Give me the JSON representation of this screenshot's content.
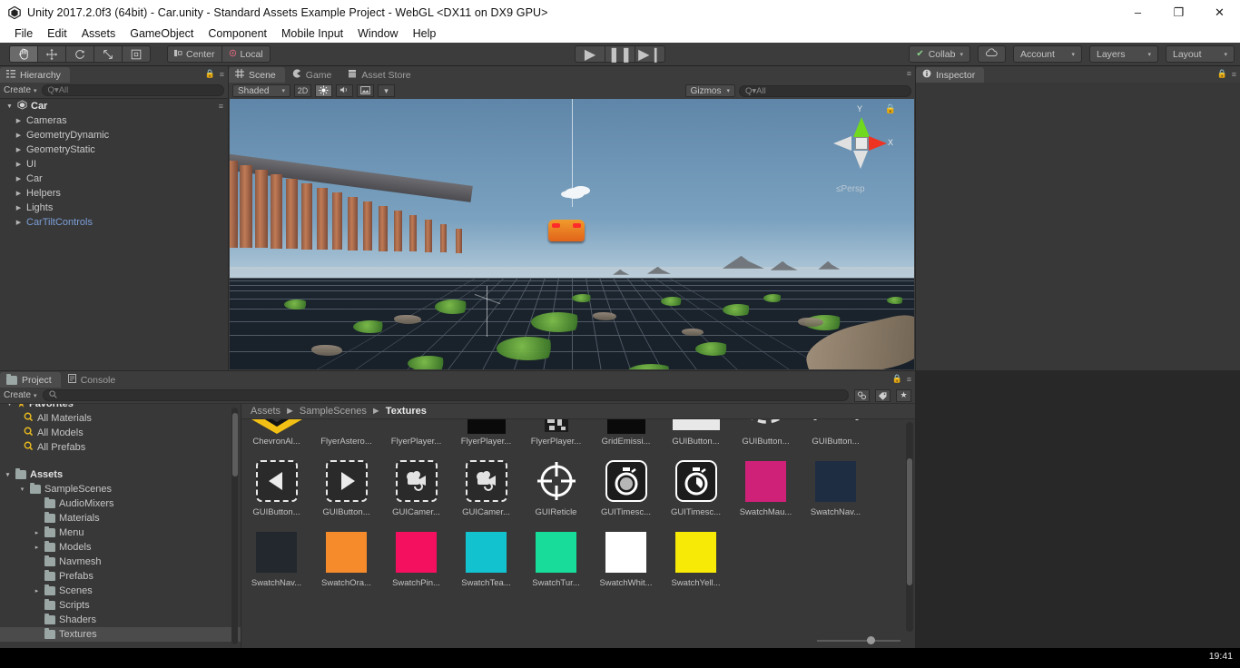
{
  "window": {
    "title": "Unity 2017.2.0f3 (64bit) - Car.unity - Standard Assets Example Project - WebGL <DX11 on DX9 GPU>",
    "app_icon": "unity-logo-icon",
    "minimize": "–",
    "maximize": "❐",
    "close": "✕"
  },
  "menubar": {
    "items": [
      "File",
      "Edit",
      "Assets",
      "GameObject",
      "Component",
      "Mobile Input",
      "Window",
      "Help"
    ]
  },
  "toolbar": {
    "transform_tools": [
      {
        "name": "hand-tool",
        "glyph": "✋",
        "active": true
      },
      {
        "name": "move-tool",
        "glyph": "✥",
        "active": false
      },
      {
        "name": "rotate-tool",
        "glyph": "⟳",
        "active": false
      },
      {
        "name": "scale-tool",
        "glyph": "⤢",
        "active": false
      },
      {
        "name": "rect-tool",
        "glyph": "⬚",
        "active": false
      }
    ],
    "pivot_label": "Center",
    "pivot_icon": "pivot-center-icon",
    "rotation_label": "Local",
    "rotation_icon": "rotation-local-icon",
    "play": "▶",
    "pause": "❚❚",
    "step": "▶❙",
    "collab_label": "Collab",
    "collab_check": "✔",
    "cloud_icon": "cloud-icon",
    "account_label": "Account",
    "layers_label": "Layers",
    "layout_label": "Layout",
    "caret": "▾"
  },
  "hierarchy": {
    "tab_label": "Hierarchy",
    "tab_icon": "hierarchy-icon",
    "create_label": "Create",
    "search_placeholder": "Q▾All",
    "lock_icon": "lock-icon",
    "menu_icon": "panel-menu-icon",
    "root": {
      "label": "Car",
      "icon": "unity-scene-icon"
    },
    "items": [
      {
        "label": "Cameras",
        "prefab": false
      },
      {
        "label": "GeometryDynamic",
        "prefab": false
      },
      {
        "label": "GeometryStatic",
        "prefab": false
      },
      {
        "label": "UI",
        "prefab": false
      },
      {
        "label": "Car",
        "prefab": false
      },
      {
        "label": "Helpers",
        "prefab": false
      },
      {
        "label": "Lights",
        "prefab": false
      },
      {
        "label": "CarTiltControls",
        "prefab": true
      }
    ]
  },
  "scene_panel": {
    "tabs": [
      {
        "label": "Scene",
        "icon": "scene-grid-icon",
        "active": true
      },
      {
        "label": "Game",
        "icon": "game-pacman-icon",
        "active": false
      },
      {
        "label": "Asset Store",
        "icon": "asset-store-icon",
        "active": false
      }
    ],
    "shading_mode": "Shaded",
    "mode_2d": "2D",
    "lighting_icon": "lighting-sun-icon",
    "audio_icon": "audio-speaker-icon",
    "effects_icon": "effects-image-icon",
    "gizmos_label": "Gizmos",
    "gizmos_search_placeholder": "Q▾All",
    "axis_labels": {
      "y": "Y",
      "x": "X"
    },
    "projection_label": "Persp",
    "projection_arrow": "≤",
    "lock_icon": "lock-icon",
    "menu_icon": "panel-menu-icon"
  },
  "inspector": {
    "tab_label": "Inspector",
    "tab_icon": "info-icon",
    "lock_icon": "lock-icon",
    "menu_icon": "panel-menu-icon"
  },
  "project_panel": {
    "tabs": [
      {
        "label": "Project",
        "icon": "folder-icon",
        "active": true
      },
      {
        "label": "Console",
        "icon": "console-icon",
        "active": false
      }
    ],
    "create_label": "Create",
    "search_placeholder": "",
    "search_icon": "search-icon",
    "filter_icons": [
      "asset-type-filter-icon",
      "label-filter-icon",
      "favorite-star-icon"
    ],
    "lock_icon": "lock-icon",
    "menu_icon": "panel-menu-icon",
    "favorites": {
      "label": "Favorites",
      "items": [
        "All Materials",
        "All Models",
        "All Prefabs"
      ]
    },
    "tree": [
      {
        "label": "Assets",
        "depth": 0,
        "expanded": true,
        "bold": true,
        "selected": false,
        "arrow": "▾"
      },
      {
        "label": "SampleScenes",
        "depth": 1,
        "expanded": true,
        "bold": false,
        "selected": false,
        "arrow": "▾"
      },
      {
        "label": "AudioMixers",
        "depth": 2,
        "expanded": false,
        "bold": false,
        "selected": false,
        "arrow": ""
      },
      {
        "label": "Materials",
        "depth": 2,
        "expanded": false,
        "bold": false,
        "selected": false,
        "arrow": ""
      },
      {
        "label": "Menu",
        "depth": 2,
        "expanded": false,
        "bold": false,
        "selected": false,
        "arrow": "▸"
      },
      {
        "label": "Models",
        "depth": 2,
        "expanded": false,
        "bold": false,
        "selected": false,
        "arrow": "▸"
      },
      {
        "label": "Navmesh",
        "depth": 2,
        "expanded": false,
        "bold": false,
        "selected": false,
        "arrow": ""
      },
      {
        "label": "Prefabs",
        "depth": 2,
        "expanded": false,
        "bold": false,
        "selected": false,
        "arrow": ""
      },
      {
        "label": "Scenes",
        "depth": 2,
        "expanded": false,
        "bold": false,
        "selected": false,
        "arrow": "▸"
      },
      {
        "label": "Scripts",
        "depth": 2,
        "expanded": false,
        "bold": false,
        "selected": false,
        "arrow": ""
      },
      {
        "label": "Shaders",
        "depth": 2,
        "expanded": false,
        "bold": false,
        "selected": false,
        "arrow": ""
      },
      {
        "label": "Textures",
        "depth": 2,
        "expanded": false,
        "bold": false,
        "selected": true,
        "arrow": ""
      }
    ],
    "breadcrumb": [
      "Assets",
      "SampleScenes",
      "Textures"
    ],
    "breadcrumb_sep": "►",
    "assets": [
      [
        {
          "label": "ChevronAl...",
          "kind": "chevron",
          "color": "#f2c014"
        },
        {
          "label": "FlyerAstero...",
          "kind": "blank",
          "color": "#3a3a3a"
        },
        {
          "label": "FlyerPlayer...",
          "kind": "blank",
          "color": "#3a3a3a"
        },
        {
          "label": "FlyerPlayer...",
          "kind": "black",
          "color": "#0a0a0a"
        },
        {
          "label": "FlyerPlayer...",
          "kind": "noise",
          "color": "#c9c9c9"
        },
        {
          "label": "GridEmissi...",
          "kind": "black",
          "color": "#0a0a0a"
        },
        {
          "label": "GUIButton...",
          "kind": "whitebar",
          "color": "#e8e8e8"
        },
        {
          "label": "GUIButton...",
          "kind": "dashcurve",
          "color": "#dcdcdc"
        },
        {
          "label": "GUIButton...",
          "kind": "dashline",
          "color": "#dcdcdc"
        }
      ],
      [
        {
          "label": "GUIButton...",
          "kind": "arrow-left",
          "color": "#ececec"
        },
        {
          "label": "GUIButton...",
          "kind": "arrow-right",
          "color": "#ececec"
        },
        {
          "label": "GUICamer...",
          "kind": "camera-dashed",
          "color": "#e3e3e3"
        },
        {
          "label": "GUICamer...",
          "kind": "camera-dashed",
          "color": "#e3e3e3"
        },
        {
          "label": "GUIReticle",
          "kind": "reticle",
          "color": "#ffffff"
        },
        {
          "label": "GUITimesc...",
          "kind": "stopwatch-full",
          "color": "#ffffff"
        },
        {
          "label": "GUITimesc...",
          "kind": "stopwatch-half",
          "color": "#ffffff"
        },
        {
          "label": "SwatchMau...",
          "kind": "swatch",
          "color": "#cf2178"
        },
        {
          "label": "SwatchNav...",
          "kind": "swatch",
          "color": "#1f2d42"
        }
      ],
      [
        {
          "label": "SwatchNav...",
          "kind": "swatch",
          "color": "#22282e"
        },
        {
          "label": "SwatchOra...",
          "kind": "swatch",
          "color": "#f58b2b"
        },
        {
          "label": "SwatchPin...",
          "kind": "swatch",
          "color": "#f50f5f"
        },
        {
          "label": "SwatchTea...",
          "kind": "swatch",
          "color": "#12c3cf"
        },
        {
          "label": "SwatchTur...",
          "kind": "swatch",
          "color": "#17dc9a"
        },
        {
          "label": "SwatchWhit...",
          "kind": "swatch",
          "color": "#ffffff"
        },
        {
          "label": "SwatchYell...",
          "kind": "swatch",
          "color": "#f7ea06"
        }
      ]
    ]
  },
  "taskbar": {
    "time": "19:41"
  },
  "colors": {
    "panel_bg": "#383838",
    "chrome_bg": "#3c3c3c",
    "accent_prefab": "#7c9fd8",
    "selection": "#4b4b4b"
  }
}
